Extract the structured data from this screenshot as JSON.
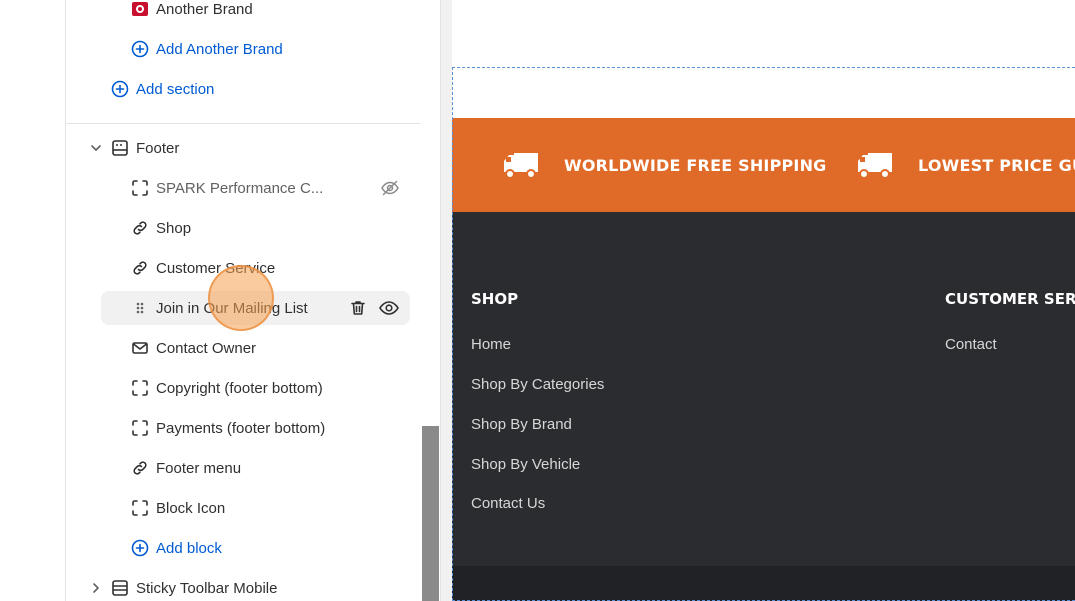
{
  "sidebar": {
    "brand_item": "Another Brand",
    "add_brand": "Add Another Brand",
    "add_section": "Add section",
    "footer_section": "Footer",
    "footer_blocks": [
      "SPARK Performance C...",
      "Shop",
      "Customer Service",
      "Join in Our Mailing List",
      "Contact Owner",
      "Copyright (footer bottom)",
      "Payments (footer bottom)",
      "Footer menu",
      "Block Icon"
    ],
    "add_block": "Add block",
    "next_section": "Sticky Toolbar Mobile"
  },
  "preview": {
    "banner": [
      "WORLDWIDE FREE SHIPPING",
      "LOWEST PRICE GUARANTEE"
    ],
    "shop_title": "SHOP",
    "shop_links": [
      "Home",
      "Shop By Categories",
      "Shop By Brand",
      "Shop By Vehicle",
      "Contact Us"
    ],
    "service_title": "CUSTOMER SERVICE",
    "service_links": [
      "Contact"
    ]
  },
  "colors": {
    "accent_blue": "#005bd3",
    "banner_orange": "#e06b28",
    "footer_dark": "#2b2c30"
  }
}
